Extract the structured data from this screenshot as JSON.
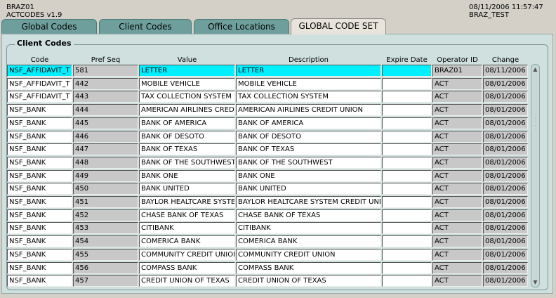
{
  "header": {
    "user": "BRAZ01",
    "form": "ACTCODES   v1.9",
    "datetime": "08/11/2006 11:57:47",
    "env": "BRAZ_TEST"
  },
  "tabs": [
    {
      "label": "Global Codes"
    },
    {
      "label": "Client Codes"
    },
    {
      "label": "Office Locations"
    },
    {
      "label": "GLOBAL CODE SET"
    }
  ],
  "section_title": "Client Codes",
  "columns": [
    "Code",
    "Pref Seq",
    "Value",
    "Description",
    "Expire Date",
    "Operator ID",
    "Change Date"
  ],
  "rows": [
    {
      "code": "NSF_AFFIDAVIT_T",
      "seq": "581",
      "value": "LETTER",
      "desc": "LETTER",
      "expire": "",
      "op": "BRAZ01",
      "chg": "08/11/2006"
    },
    {
      "code": "NSF_AFFIDAVIT_T",
      "seq": "442",
      "value": "MOBILE VEHICLE",
      "desc": "MOBILE VEHICLE",
      "expire": "",
      "op": "ACT",
      "chg": "08/01/2006"
    },
    {
      "code": "NSF_AFFIDAVIT_T",
      "seq": "443",
      "value": "TAX COLLECTION SYSTEM",
      "desc": "TAX COLLECTION SYSTEM",
      "expire": "",
      "op": "ACT",
      "chg": "08/01/2006"
    },
    {
      "code": "NSF_BANK",
      "seq": "444",
      "value": "AMERICAN AIRLINES CREDIT UNION",
      "desc": "AMERICAN AIRLINES CREDIT UNION",
      "expire": "",
      "op": "ACT",
      "chg": "08/01/2006"
    },
    {
      "code": "NSF_BANK",
      "seq": "445",
      "value": "BANK OF AMERICA",
      "desc": "BANK OF AMERICA",
      "expire": "",
      "op": "ACT",
      "chg": "08/01/2006"
    },
    {
      "code": "NSF_BANK",
      "seq": "446",
      "value": "BANK OF DESOTO",
      "desc": "BANK OF DESOTO",
      "expire": "",
      "op": "ACT",
      "chg": "08/01/2006"
    },
    {
      "code": "NSF_BANK",
      "seq": "447",
      "value": "BANK OF TEXAS",
      "desc": "BANK OF TEXAS",
      "expire": "",
      "op": "ACT",
      "chg": "08/01/2006"
    },
    {
      "code": "NSF_BANK",
      "seq": "448",
      "value": "BANK OF THE SOUTHWEST",
      "desc": "BANK OF THE SOUTHWEST",
      "expire": "",
      "op": "ACT",
      "chg": "08/01/2006"
    },
    {
      "code": "NSF_BANK",
      "seq": "449",
      "value": "BANK ONE",
      "desc": "BANK ONE",
      "expire": "",
      "op": "ACT",
      "chg": "08/01/2006"
    },
    {
      "code": "NSF_BANK",
      "seq": "450",
      "value": "BANK UNITED",
      "desc": "BANK UNITED",
      "expire": "",
      "op": "ACT",
      "chg": "08/01/2006"
    },
    {
      "code": "NSF_BANK",
      "seq": "451",
      "value": "BAYLOR HEALTCARE SYSTEM",
      "desc": "BAYLOR HEALTCARE SYSTEM CREDIT UNION",
      "expire": "",
      "op": "ACT",
      "chg": "08/01/2006"
    },
    {
      "code": "NSF_BANK",
      "seq": "452",
      "value": "CHASE BANK OF TEXAS",
      "desc": "CHASE BANK OF TEXAS",
      "expire": "",
      "op": "ACT",
      "chg": "08/01/2006"
    },
    {
      "code": "NSF_BANK",
      "seq": "453",
      "value": "CITIBANK",
      "desc": "CITIBANK",
      "expire": "",
      "op": "ACT",
      "chg": "08/01/2006"
    },
    {
      "code": "NSF_BANK",
      "seq": "454",
      "value": "COMERICA BANK",
      "desc": "COMERICA BANK",
      "expire": "",
      "op": "ACT",
      "chg": "08/01/2006"
    },
    {
      "code": "NSF_BANK",
      "seq": "455",
      "value": "COMMUNITY CREDIT UNION",
      "desc": "COMMUNITY CREDIT UNION",
      "expire": "",
      "op": "ACT",
      "chg": "08/01/2006"
    },
    {
      "code": "NSF_BANK",
      "seq": "456",
      "value": "COMPASS BANK",
      "desc": "COMPASS BANK",
      "expire": "",
      "op": "ACT",
      "chg": "08/01/2006"
    },
    {
      "code": "NSF_BANK",
      "seq": "457",
      "value": "CREDIT UNION OF TEXAS",
      "desc": "CREDIT UNION OF TEXAS",
      "expire": "",
      "op": "ACT",
      "chg": "08/01/2006"
    }
  ],
  "colors": {
    "selected_row": "#00f0ff",
    "tab": "#6f9f9c",
    "panel": "#cfe0df"
  }
}
